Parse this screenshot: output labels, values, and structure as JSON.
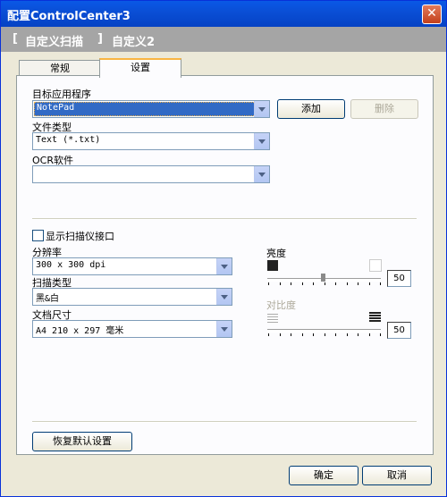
{
  "window": {
    "title": "配置ControlCenter3",
    "close_symbol": "✕"
  },
  "header": {
    "bracket_open": "[",
    "section": "自定义扫描",
    "bracket_close": "]",
    "name": "自定义2"
  },
  "tabs": [
    {
      "label": "常规"
    },
    {
      "label": "设置"
    }
  ],
  "target_app": {
    "label": "目标应用程序",
    "value": "NotePad",
    "add": "添加",
    "delete": "删除"
  },
  "file_type": {
    "label": "文件类型",
    "value": "Text (*.txt)"
  },
  "ocr": {
    "label": "OCR软件",
    "value": ""
  },
  "scanner_interface": {
    "label": "显示扫描仪接口"
  },
  "resolution": {
    "label": "分辨率",
    "value": "300 x 300 dpi"
  },
  "scan_type": {
    "label": "扫描类型",
    "value": "黑&白"
  },
  "doc_size": {
    "label": "文档尺寸",
    "value": "A4 210 x 297 毫米"
  },
  "brightness": {
    "label": "亮度",
    "value": "50"
  },
  "contrast": {
    "label": "对比度",
    "value": "50"
  },
  "restore_defaults": "恢复默认设置",
  "ok": "确定",
  "cancel": "取消"
}
